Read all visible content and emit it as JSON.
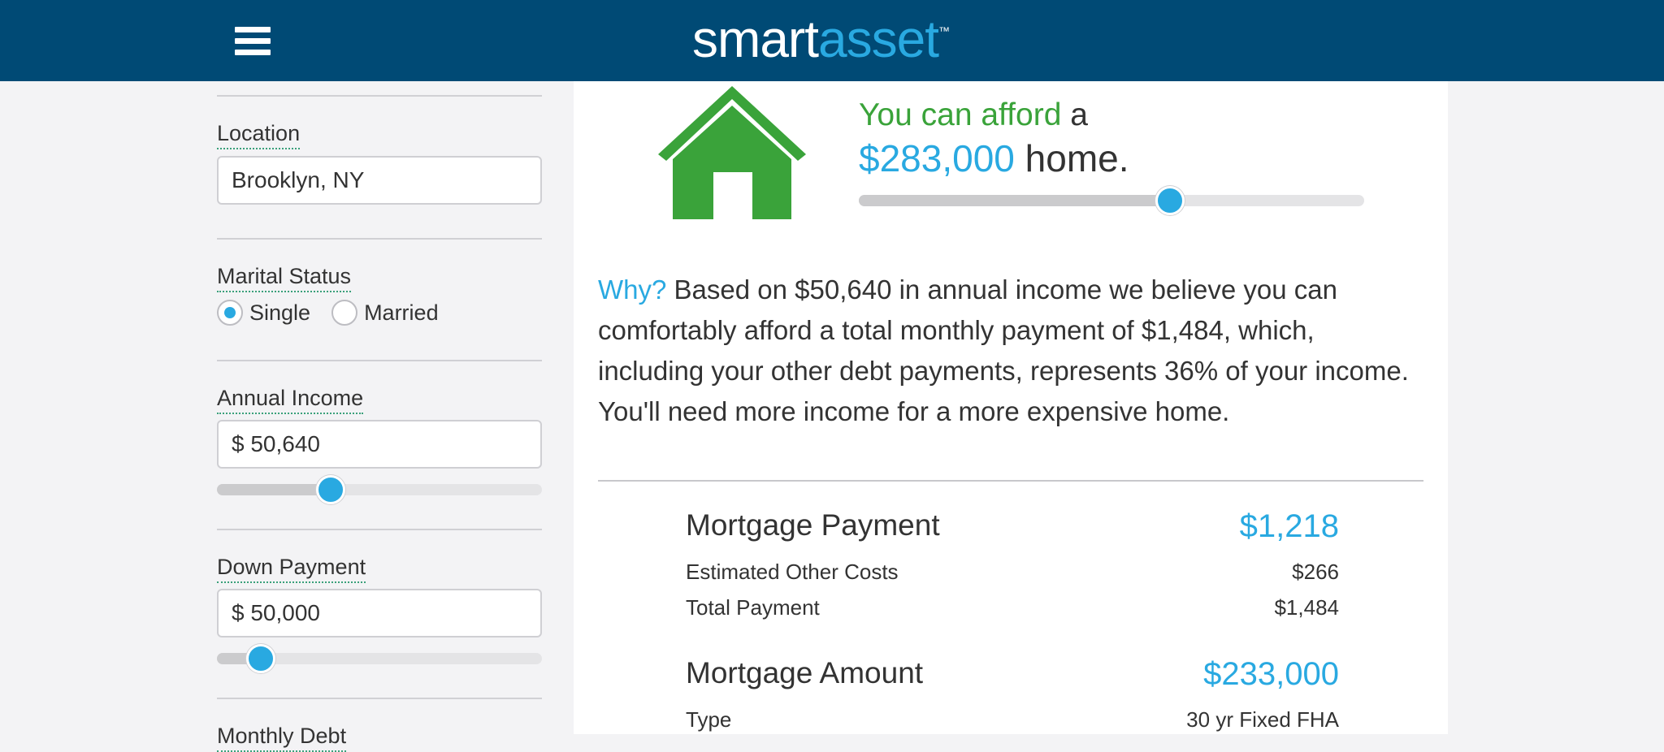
{
  "header": {
    "logo_part1": "smart",
    "logo_part2": "asset",
    "logo_tm": "™"
  },
  "sidebar": {
    "location": {
      "label": "Location",
      "value": "Brooklyn, NY"
    },
    "marital_status": {
      "label": "Marital Status",
      "options": [
        "Single",
        "Married"
      ],
      "selected": "Single"
    },
    "annual_income": {
      "label": "Annual Income",
      "value": "$ 50,640",
      "slider_fraction": 0.35
    },
    "down_payment": {
      "label": "Down Payment",
      "value": "$ 50,000",
      "slider_fraction": 0.135
    },
    "monthly_debt": {
      "label": "Monthly Debt"
    }
  },
  "result": {
    "afford_prefix": "You can afford",
    "afford_suffix": "a",
    "amount": "$283,000",
    "amount_suffix": "home.",
    "price_slider_fraction": 0.615
  },
  "why": {
    "label": "Why?",
    "text": "Based on $50,640 in annual income we believe you can comfortably afford a total monthly payment of $1,484, which, including your other debt payments, represents 36% of your income. You'll need more income for a more expensive home."
  },
  "breakdown": {
    "mortgage_payment": {
      "label": "Mortgage Payment",
      "value": "$1,218"
    },
    "other_costs": {
      "label": "Estimated Other Costs",
      "value": "$266"
    },
    "total_payment": {
      "label": "Total Payment",
      "value": "$1,484"
    },
    "mortgage_amount": {
      "label": "Mortgage Amount",
      "value": "$233,000"
    },
    "type": {
      "label": "Type",
      "value": "30 yr Fixed FHA"
    }
  },
  "colors": {
    "header_bg": "#004a75",
    "accent_blue": "#29a9e1",
    "accent_green": "#3aa33a"
  }
}
